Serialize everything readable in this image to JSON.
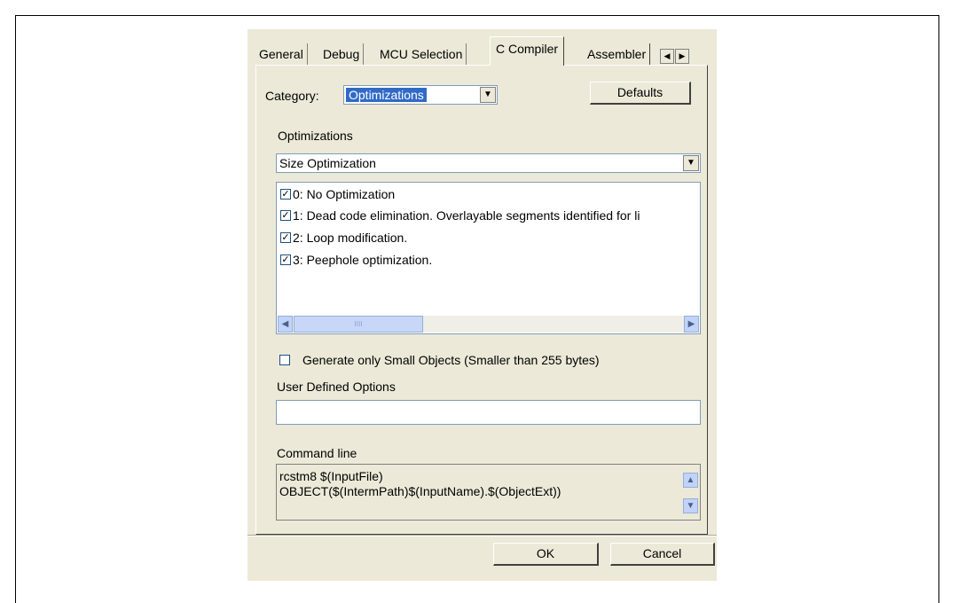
{
  "tabs": [
    {
      "label": "General"
    },
    {
      "label": "Debug"
    },
    {
      "label": "MCU Selection"
    },
    {
      "label": "C Compiler",
      "active": true
    },
    {
      "label": "Assembler"
    }
  ],
  "tab_scroll": {
    "left_icon": "arrow-left-icon",
    "right_icon": "arrow-right-icon"
  },
  "category": {
    "label": "Category:",
    "value": "Optimizations"
  },
  "defaults_button": "Defaults",
  "optimizations": {
    "section_label": "Optimizations",
    "dropdown_value": "Size Optimization",
    "items": [
      {
        "label": "0: No Optimization",
        "checked": true
      },
      {
        "label": "1: Dead code elimination. Overlayable segments identified for li",
        "checked": true
      },
      {
        "label": "2: Loop modification.",
        "checked": true
      },
      {
        "label": "3: Peephole optimization.",
        "checked": true
      }
    ],
    "scroll_thumb_glyph": "IIII"
  },
  "small_objects": {
    "label": "Generate only Small Objects (Smaller than 255 bytes)",
    "checked": false
  },
  "user_options": {
    "label": "User Defined Options",
    "value": ""
  },
  "command_line": {
    "label": "Command line",
    "lines": [
      "rcstm8 $(InputFile)",
      "OBJECT($(IntermPath)$(InputName).$(ObjectExt))"
    ]
  },
  "footer": {
    "ok": "OK",
    "cancel": "Cancel"
  },
  "colors": {
    "dialog_bg": "#ECE9D8",
    "selection": "#316AC5",
    "border": "#7F9DB9"
  }
}
